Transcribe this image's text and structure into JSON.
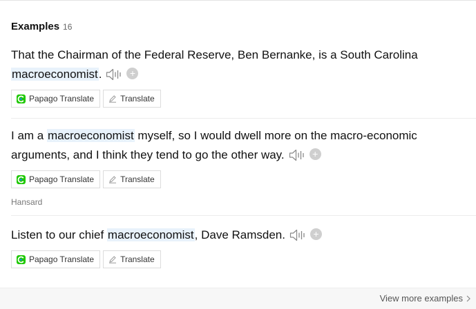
{
  "header": {
    "title": "Examples",
    "count": "16"
  },
  "examples": [
    {
      "before": "That the Chairman of the Federal Reserve, Ben Bernanke, is a South Carolina ",
      "keyword": "macroeconomist",
      "after": ".",
      "source": ""
    },
    {
      "before": "I am a ",
      "keyword": "macroeconomist",
      "after": " myself, so I would dwell more on the macro-economic arguments, and I think they tend to go the other way.",
      "source": "Hansard"
    },
    {
      "before": "Listen to our chief ",
      "keyword": "macroeconomist",
      "after": ", Dave Ramsden.",
      "source": ""
    }
  ],
  "buttons": {
    "papago": "Papago Translate",
    "translate": "Translate"
  },
  "plus_glyph": "+",
  "footer": {
    "view_more": "View more examples"
  },
  "colors": {
    "highlight": "#e8f2fb",
    "papago_green": "#1ec800",
    "papago_blue": "#1a8cff"
  },
  "icons": [
    "speaker-icon",
    "add-icon",
    "papago-icon",
    "pencil-icon",
    "chevron-right-icon"
  ]
}
